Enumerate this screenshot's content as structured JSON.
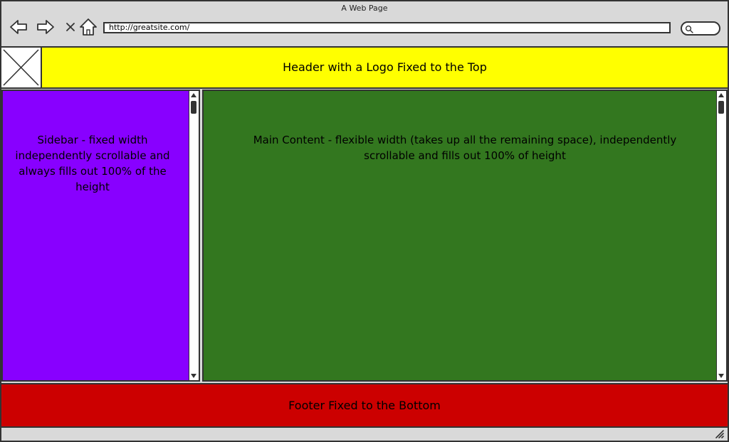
{
  "window": {
    "title": "A Web Page"
  },
  "toolbar": {
    "url": "http://greatsite.com/",
    "icons": [
      "back-arrow-icon",
      "forward-arrow-icon",
      "close-icon",
      "home-icon",
      "search-icon"
    ]
  },
  "header": {
    "text": "Header with a Logo Fixed to the Top",
    "logo_icon": "image-placeholder-icon",
    "color": "#ffff00"
  },
  "sidebar": {
    "text": "Sidebar - fixed width independently scrollable and always fills out 100% of the height",
    "color": "#8800ff"
  },
  "main": {
    "text": "Main Content - flexible width (takes up all the remaining space), independently scrollable and fills out 100% of height",
    "color": "#33771f"
  },
  "footer": {
    "text": "Footer Fixed to the Bottom",
    "color": "#cc0000"
  }
}
